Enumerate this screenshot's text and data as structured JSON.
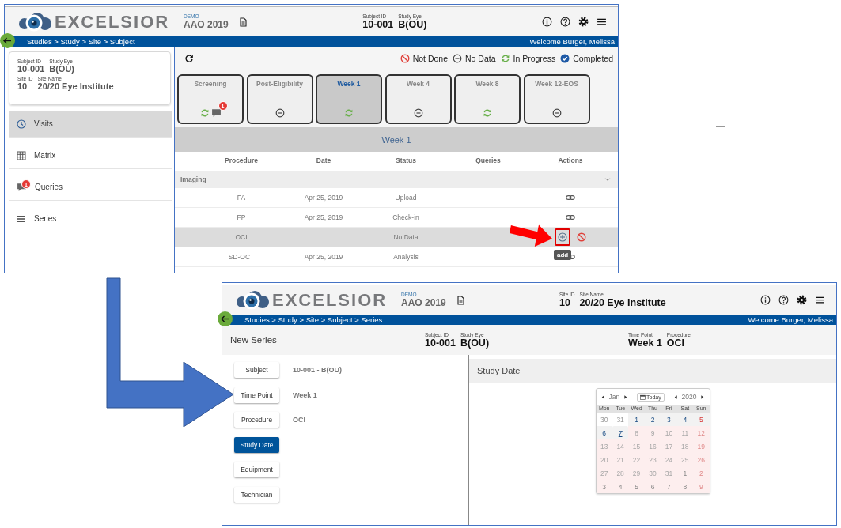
{
  "visits_screen": {
    "header": {
      "logo": "EXCELSIOR",
      "study_label": "DEMO",
      "study": "AAO 2019",
      "fields": [
        {
          "label": "Subject ID",
          "value": "10-001"
        },
        {
          "label": "Study Eye",
          "value": "B(OU)"
        }
      ]
    },
    "breadcrumb": "Studies > Study > Site > Subject",
    "welcome": "Welcome Burger, Melissa",
    "subject_card": [
      [
        {
          "label": "Subject ID",
          "value": "10-001"
        },
        {
          "label": "Study Eye",
          "value": "B(OU)"
        }
      ],
      [
        {
          "label": "Site ID",
          "value": "10"
        },
        {
          "label": "Site Name",
          "value": "20/20 Eye Institute"
        }
      ]
    ],
    "nav": [
      {
        "label": "Visits",
        "selected": true
      },
      {
        "label": "Matrix",
        "selected": false
      },
      {
        "label": "Queries",
        "selected": false,
        "badge": "1"
      },
      {
        "label": "Series",
        "selected": false
      }
    ],
    "legend": [
      {
        "kind": "not_done",
        "label": "Not Done"
      },
      {
        "kind": "no_data",
        "label": "No Data"
      },
      {
        "kind": "in_progress",
        "label": "In Progress"
      },
      {
        "kind": "completed",
        "label": "Completed"
      }
    ],
    "visits": [
      {
        "label": "Screening",
        "kind": "in_progress",
        "selected": false,
        "queries": "1"
      },
      {
        "label": "Post-Eligibility",
        "kind": "no_data",
        "selected": false
      },
      {
        "label": "Week 1",
        "kind": "in_progress",
        "selected": true
      },
      {
        "label": "Week 4",
        "kind": "no_data",
        "selected": false
      },
      {
        "label": "Week 8",
        "kind": "in_progress",
        "selected": false
      },
      {
        "label": "Week 12-EOS",
        "kind": "no_data",
        "selected": false
      }
    ],
    "section_title": "Week 1",
    "table": {
      "columns": [
        "Procedure",
        "Date",
        "Status",
        "Queries",
        "Actions"
      ],
      "group": {
        "label": "Imaging",
        "expanded": true
      },
      "rows": [
        {
          "procedure": "FA",
          "date": "Apr 25, 2019",
          "status": "Upload",
          "selected": false,
          "actions": [
            {
              "kind": "link"
            }
          ]
        },
        {
          "procedure": "FP",
          "date": "Apr 25, 2019",
          "status": "Check-in",
          "selected": false,
          "actions": [
            {
              "kind": "link"
            }
          ]
        },
        {
          "procedure": "OCI",
          "status": "No Data",
          "selected": true,
          "actions": [
            {
              "kind": "add"
            },
            {
              "kind": "not_done"
            }
          ]
        },
        {
          "procedure": "SD-OCT",
          "date": "Apr 25, 2019",
          "status": "Analysis",
          "selected": false,
          "actions": [
            {
              "kind": "link"
            }
          ]
        }
      ]
    },
    "tooltip": "add"
  },
  "series_screen": {
    "header": {
      "logo": "EXCELSIOR",
      "study_label": "DEMO",
      "study": "AAO 2019",
      "fields": [
        {
          "label": "Site ID",
          "value": "10"
        },
        {
          "label": "Site Name",
          "value": "20/20 Eye Institute"
        }
      ]
    },
    "breadcrumb": "Studies > Study > Site > Subject > Series",
    "welcome": "Welcome Burger, Melissa",
    "title": "New Series",
    "info_groups": [
      [
        {
          "label": "Subject ID",
          "value": "10-001"
        },
        {
          "label": "Study Eye",
          "value": "B(OU)"
        }
      ],
      [
        {
          "label": "Time Point",
          "value": "Week 1"
        },
        {
          "label": "Procedure",
          "value": "OCI"
        }
      ]
    ],
    "steps": [
      {
        "label": "Subject",
        "value": "10-001 - B(OU)",
        "selected": false
      },
      {
        "label": "Time Point",
        "value": "Week 1",
        "selected": false
      },
      {
        "label": "Procedure",
        "value": "OCI",
        "selected": false
      },
      {
        "label": "Study Date",
        "selected": true
      },
      {
        "label": "Equipment",
        "selected": false
      },
      {
        "label": "Technician",
        "selected": false
      }
    ],
    "panel_title": "Study Date",
    "calendar": {
      "month": "Jan",
      "today_button": "Today",
      "year": "2020",
      "weekdays": [
        "Mon",
        "Tue",
        "Wed",
        "Thu",
        "Fri",
        "Sat",
        "Sun"
      ],
      "days": [
        {
          "d": "30",
          "kind": "outside",
          "sunday": false
        },
        {
          "d": "31",
          "kind": "outside",
          "sunday": false
        },
        {
          "d": "1",
          "kind": "available",
          "sunday": false
        },
        {
          "d": "2",
          "kind": "available",
          "sunday": false
        },
        {
          "d": "3",
          "kind": "available",
          "sunday": false
        },
        {
          "d": "4",
          "kind": "available",
          "sunday": false
        },
        {
          "d": "5",
          "kind": "available",
          "sunday": true
        },
        {
          "d": "6",
          "kind": "available",
          "sunday": false
        },
        {
          "d": "7",
          "kind": "today",
          "sunday": false
        },
        {
          "d": "8",
          "kind": "disabled",
          "sunday": false
        },
        {
          "d": "9",
          "kind": "disabled",
          "sunday": false
        },
        {
          "d": "10",
          "kind": "disabled",
          "sunday": false
        },
        {
          "d": "11",
          "kind": "disabled",
          "sunday": false
        },
        {
          "d": "12",
          "kind": "disabled",
          "sunday": true
        },
        {
          "d": "13",
          "kind": "disabled",
          "sunday": false
        },
        {
          "d": "14",
          "kind": "disabled",
          "sunday": false
        },
        {
          "d": "15",
          "kind": "disabled",
          "sunday": false
        },
        {
          "d": "16",
          "kind": "disabled",
          "sunday": false
        },
        {
          "d": "17",
          "kind": "disabled",
          "sunday": false
        },
        {
          "d": "18",
          "kind": "disabled",
          "sunday": false
        },
        {
          "d": "19",
          "kind": "disabled",
          "sunday": true
        },
        {
          "d": "20",
          "kind": "disabled",
          "sunday": false
        },
        {
          "d": "21",
          "kind": "disabled",
          "sunday": false
        },
        {
          "d": "22",
          "kind": "disabled",
          "sunday": false
        },
        {
          "d": "23",
          "kind": "disabled",
          "sunday": false
        },
        {
          "d": "24",
          "kind": "disabled",
          "sunday": false
        },
        {
          "d": "25",
          "kind": "disabled",
          "sunday": false
        },
        {
          "d": "26",
          "kind": "disabled",
          "sunday": true
        },
        {
          "d": "27",
          "kind": "disabled",
          "sunday": false
        },
        {
          "d": "28",
          "kind": "disabled",
          "sunday": false
        },
        {
          "d": "29",
          "kind": "disabled",
          "sunday": false
        },
        {
          "d": "30",
          "kind": "disabled",
          "sunday": false
        },
        {
          "d": "31",
          "kind": "disabled",
          "sunday": false
        },
        {
          "d": "1",
          "kind": "next",
          "sunday": false
        },
        {
          "d": "2",
          "kind": "next",
          "sunday": true
        },
        {
          "d": "3",
          "kind": "next",
          "sunday": false
        },
        {
          "d": "4",
          "kind": "next",
          "sunday": false
        },
        {
          "d": "5",
          "kind": "next",
          "sunday": false
        },
        {
          "d": "6",
          "kind": "next",
          "sunday": false
        },
        {
          "d": "7",
          "kind": "next",
          "sunday": false
        },
        {
          "d": "8",
          "kind": "next",
          "sunday": false
        },
        {
          "d": "9",
          "kind": "next",
          "sunday": true
        }
      ]
    }
  }
}
